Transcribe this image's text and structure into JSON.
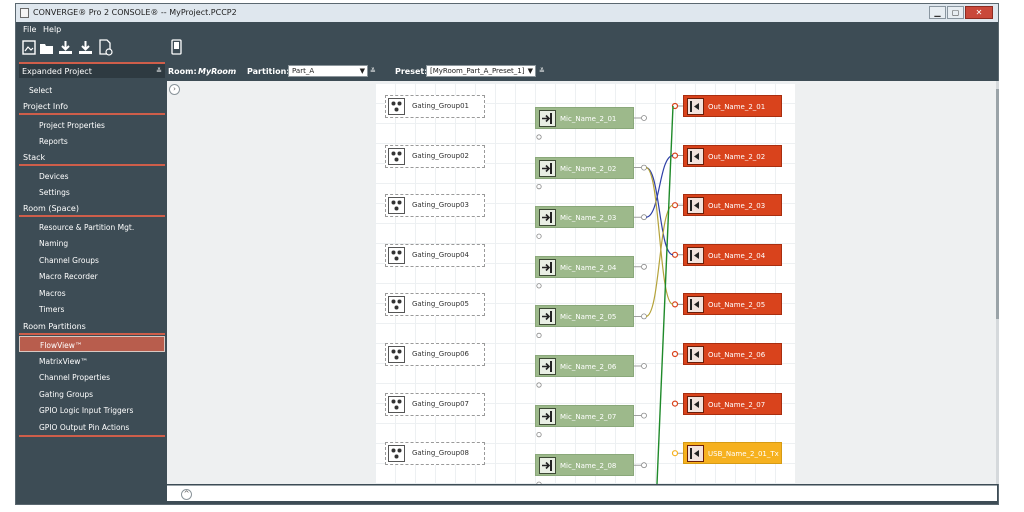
{
  "window": {
    "title": "CONVERGE® Pro 2 CONSOLE® -- MyProject.PCCP2",
    "buttons": {
      "minimize": "▁",
      "maximize": "▢",
      "close": "✕"
    }
  },
  "menu": {
    "file": "File",
    "help": "Help"
  },
  "toolbar": {
    "icons": [
      "new-project-icon",
      "open-folder-icon",
      "download-icon",
      "download-all-icon",
      "export-document-icon",
      "device-icon"
    ]
  },
  "sidebar": {
    "header": "Expanded Project",
    "collapse_glyph": "≚",
    "select": "Select",
    "sections": {
      "project_info": "Project Info",
      "stack": "Stack",
      "room_space": "Room (Space)",
      "room_partitions": "Room Partitions"
    },
    "items": {
      "project_properties": "Project Properties",
      "reports": "Reports",
      "devices": "Devices",
      "settings": "Settings",
      "resource_partition": "Resource & Partition Mgt.",
      "naming": "Naming",
      "channel_groups": "Channel Groups",
      "macro_recorder": "Macro Recorder",
      "macros": "Macros",
      "timers": "Timers",
      "flowview": "FlowView™",
      "matrixview": "MatrixView™",
      "channel_properties": "Channel Properties",
      "gating_groups": "Gating Groups",
      "gpio_input": "GPIO Logic Input Triggers",
      "gpio_output": "GPIO Output Pin Actions"
    }
  },
  "options": {
    "room_label": "Room:",
    "room_value": "MyRoom",
    "partition_label": "Partition:",
    "partition_value": "Part_A",
    "preset_label": "Preset:",
    "preset_value": "[MyRoom_Part_A_Preset_1]",
    "dropdown_glyph": "▼",
    "expand_glyph": "≚"
  },
  "canvas": {
    "expand_glyph": "›",
    "collapse_glyph": "^",
    "gating_groups": [
      "Gating_Group01",
      "Gating_Group02",
      "Gating_Group03",
      "Gating_Group04",
      "Gating_Group05",
      "Gating_Group06",
      "Gating_Group07",
      "Gating_Group08"
    ],
    "mics": [
      "Mic_Name_2_01",
      "Mic_Name_2_02",
      "Mic_Name_2_03",
      "Mic_Name_2_04",
      "Mic_Name_2_05",
      "Mic_Name_2_06",
      "Mic_Name_2_07",
      "Mic_Name_2_08"
    ],
    "outputs": [
      "Out_Name_2_01",
      "Out_Name_2_02",
      "Out_Name_2_03",
      "Out_Name_2_04",
      "Out_Name_2_05",
      "Out_Name_2_06",
      "Out_Name_2_07",
      "USB_Name_2_01_Tx"
    ],
    "colors": {
      "mic": "#9db98b",
      "output": "#d9431c",
      "usb": "#f6b11f",
      "wire_blue": "#2d3fa6",
      "wire_olive": "#b5a33a",
      "wire_green": "#1f8a2a"
    }
  }
}
